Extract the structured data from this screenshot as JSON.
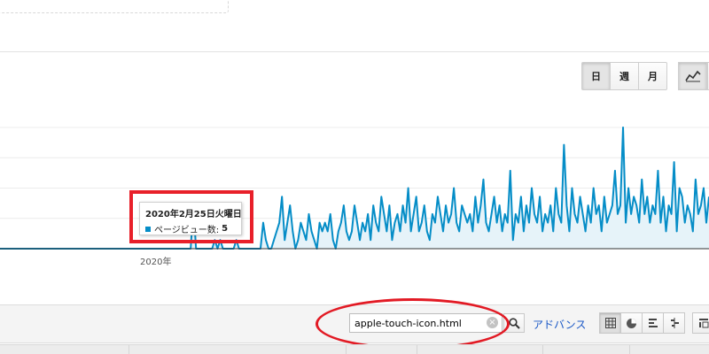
{
  "period_buttons": {
    "day": "日",
    "week": "週",
    "month": "月",
    "selected": "日"
  },
  "chart_type_buttons": [
    "line-chart-icon",
    "motion-chart-icon"
  ],
  "tooltip": {
    "date": "2020年2月25日火曜日",
    "metric_label": "ページビュー数:",
    "metric_value": "5"
  },
  "x_axis_label": "2020年",
  "search": {
    "value": "apple-touch-icon.html",
    "advanced_link": "アドバンス"
  },
  "view_buttons": [
    "table-icon",
    "pie-chart-icon",
    "performance-icon",
    "comparison-icon",
    "pivot-icon"
  ],
  "colors": {
    "series": "#058dc7",
    "fill": "#e6f3f9",
    "highlight": "#e21a24",
    "link": "#1a58c6"
  },
  "chart_data": {
    "type": "line",
    "series": [
      {
        "name": "ページビュー数",
        "values": [
          0,
          0,
          0,
          0,
          0,
          0,
          0,
          0,
          0,
          0,
          0,
          0,
          0,
          0,
          0,
          0,
          0,
          0,
          0,
          0,
          0,
          0,
          0,
          0,
          0,
          0,
          0,
          0,
          0,
          0,
          0,
          0,
          0,
          0,
          0,
          0,
          0,
          0,
          0,
          0,
          0,
          0,
          0,
          0,
          0,
          0,
          0,
          0,
          0,
          0,
          0,
          0,
          0,
          0,
          0,
          0,
          0,
          0,
          0,
          0,
          0,
          0,
          0,
          0,
          0,
          0,
          0,
          0,
          0,
          0,
          0,
          0,
          5,
          0,
          0,
          0,
          0,
          0,
          0,
          0,
          1,
          0,
          1,
          0,
          0,
          0,
          0,
          0,
          1,
          0,
          0,
          0,
          0,
          0,
          0,
          0,
          0,
          0,
          3,
          1,
          0,
          0,
          1,
          2,
          3,
          6,
          1,
          3,
          5,
          2,
          0,
          1,
          3,
          2,
          1,
          4,
          2,
          1,
          0,
          3,
          2,
          3,
          2,
          4,
          1,
          0,
          2,
          3,
          5,
          2,
          1,
          2,
          5,
          3,
          1,
          3,
          2,
          4,
          1,
          5,
          3,
          2,
          6,
          4,
          2,
          5,
          1,
          3,
          4,
          2,
          5,
          3,
          7,
          2,
          4,
          6,
          2,
          3,
          5,
          2,
          1,
          4,
          3,
          6,
          4,
          2,
          5,
          3,
          4,
          7,
          3,
          2,
          5,
          4,
          3,
          4,
          2,
          6,
          3,
          5,
          8,
          3,
          2,
          4,
          6,
          3,
          5,
          2,
          4,
          3,
          9,
          1,
          4,
          3,
          6,
          2,
          5,
          3,
          7,
          4,
          3,
          6,
          2,
          4,
          3,
          5,
          2,
          7,
          4,
          3,
          12,
          5,
          2,
          7,
          4,
          3,
          6,
          4,
          2,
          5,
          3,
          7,
          4,
          5,
          2,
          6,
          3,
          4,
          5,
          9,
          4,
          5,
          14,
          3,
          7,
          4,
          6,
          5,
          3,
          8,
          4,
          6,
          3,
          5,
          4,
          9,
          3,
          6,
          2,
          5,
          4,
          10,
          2,
          7,
          6,
          3,
          5,
          4,
          2,
          8,
          4,
          5,
          7,
          3,
          6
        ]
      }
    ],
    "x_tick_labels": [
      "2020年"
    ],
    "legend": "none",
    "grid": true
  }
}
